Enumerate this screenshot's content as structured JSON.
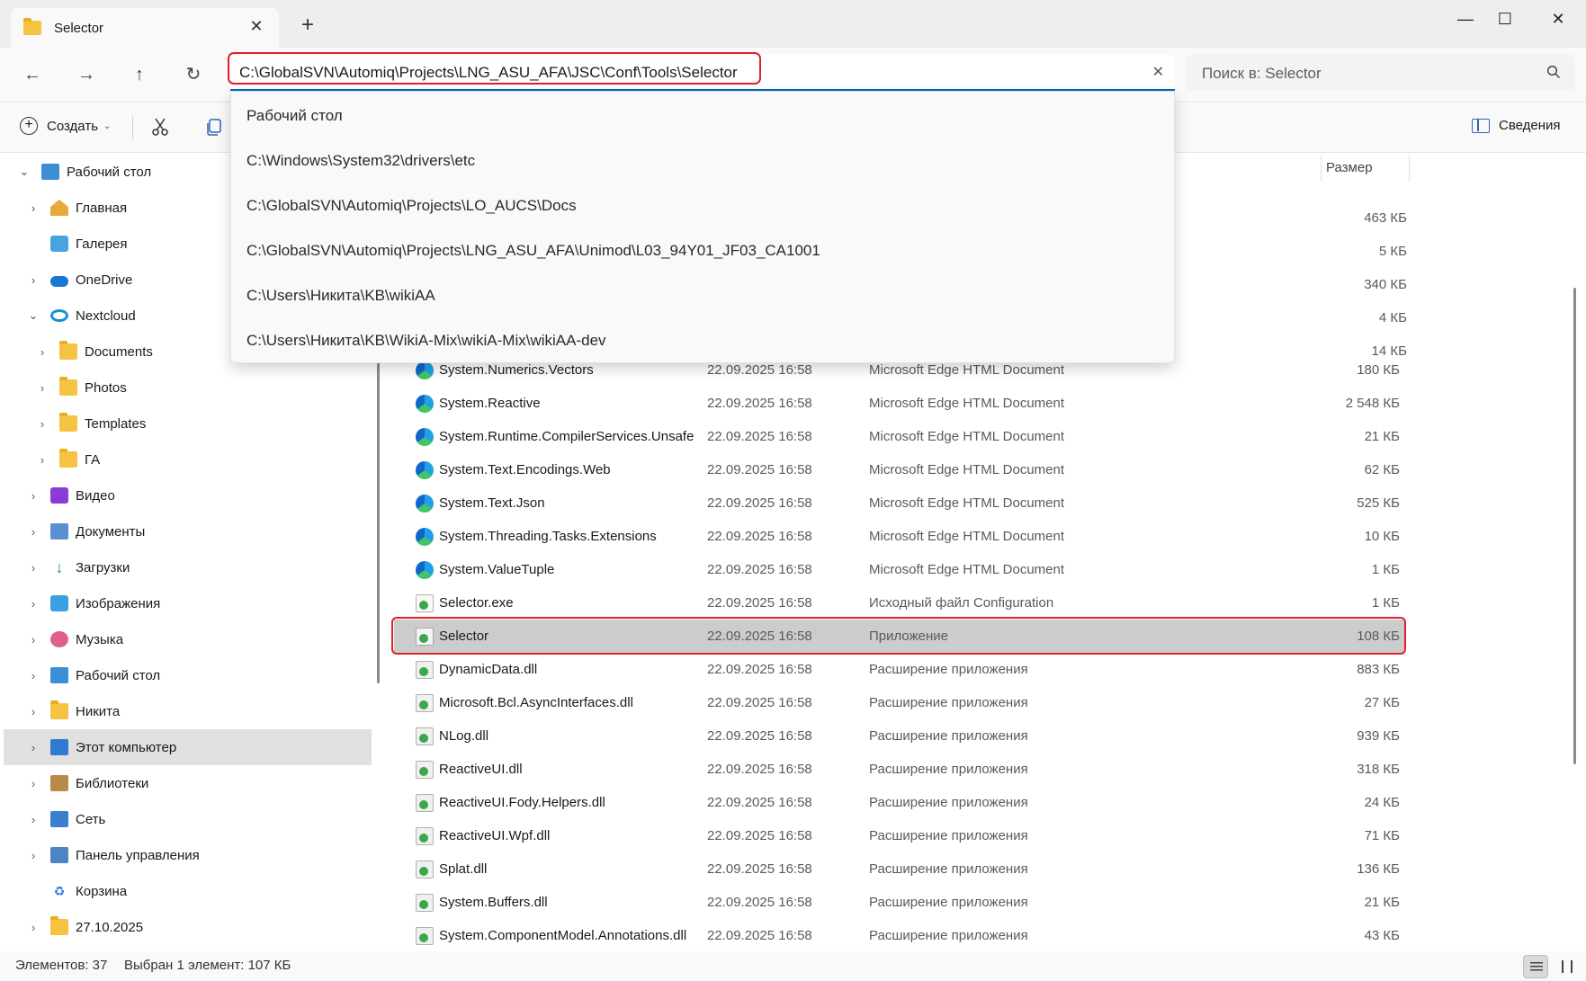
{
  "window": {
    "tab_title": "Selector",
    "tab_close": "✕",
    "new_tab": "+",
    "minimize": "—",
    "maximize": "☐",
    "close": "✕"
  },
  "nav": {
    "back": "←",
    "forward": "→",
    "up": "↑",
    "refresh": "↻",
    "address_value": "C:\\GlobalSVN\\Automiq\\Projects\\LNG_ASU_AFA\\JSC\\Conf\\Tools\\Selector",
    "address_clear": "✕",
    "search_placeholder": "Поиск в: Selector"
  },
  "address_suggestions": [
    "Рабочий стол",
    "C:\\Windows\\System32\\drivers\\etc",
    "C:\\GlobalSVN\\Automiq\\Projects\\LO_AUCS\\Docs",
    "C:\\GlobalSVN\\Automiq\\Projects\\LNG_ASU_AFA\\Unimod\\L03_94Y01_JF03_CA1001",
    "C:\\Users\\Никита\\KB\\wikiAA",
    "C:\\Users\\Никита\\KB\\WikiA-Mix\\wikiA-Mix\\wikiAA-dev"
  ],
  "toolbar": {
    "create_label": "Создать",
    "create_chevron": "⌄",
    "details_label": "Сведения"
  },
  "sidebar": {
    "items": [
      {
        "label": "Рабочий стол",
        "chevron": "⌄",
        "icon": "desktop-icon"
      },
      {
        "label": "Главная",
        "chevron": "›",
        "icon": "home-icon"
      },
      {
        "label": "Галерея",
        "chevron": "",
        "icon": "gallery-icon"
      },
      {
        "label": "OneDrive",
        "chevron": "›",
        "icon": "onedrive-icon"
      },
      {
        "label": "Nextcloud",
        "chevron": "⌄",
        "icon": "nextcloud-icon"
      },
      {
        "label": "Documents",
        "chevron": "›",
        "icon": "folder-icon"
      },
      {
        "label": "Photos",
        "chevron": "›",
        "icon": "folder-icon"
      },
      {
        "label": "Templates",
        "chevron": "›",
        "icon": "folder-icon"
      },
      {
        "label": "ГА",
        "chevron": "›",
        "icon": "folder-icon"
      },
      {
        "label": "Видео",
        "chevron": "›",
        "icon": "video-icon"
      },
      {
        "label": "Документы",
        "chevron": "›",
        "icon": "documents-icon"
      },
      {
        "label": "Загрузки",
        "chevron": "›",
        "icon": "downloads-icon"
      },
      {
        "label": "Изображения",
        "chevron": "›",
        "icon": "pictures-icon"
      },
      {
        "label": "Музыка",
        "chevron": "›",
        "icon": "music-icon"
      },
      {
        "label": "Рабочий стол",
        "chevron": "›",
        "icon": "desktop-folder-icon"
      },
      {
        "label": "Никита",
        "chevron": "›",
        "icon": "user-folder-icon"
      },
      {
        "label": "Этот компьютер",
        "chevron": "›",
        "icon": "this-pc-icon"
      },
      {
        "label": "Библиотеки",
        "chevron": "›",
        "icon": "libraries-icon"
      },
      {
        "label": "Сеть",
        "chevron": "›",
        "icon": "network-icon"
      },
      {
        "label": "Панель управления",
        "chevron": "›",
        "icon": "control-panel-icon"
      },
      {
        "label": "Корзина",
        "chevron": "",
        "icon": "recycle-bin-icon"
      },
      {
        "label": "27.10.2025",
        "chevron": "›",
        "icon": "folder-icon"
      }
    ]
  },
  "filelist": {
    "size_header": "Размер",
    "hidden_sizes": [
      "463 КБ",
      "5 КБ",
      "340 КБ",
      "4 КБ",
      "14 КБ"
    ],
    "rows": [
      {
        "name": "System.Numerics.Vectors",
        "date": "22.09.2025 16:58",
        "type": "Microsoft Edge HTML Document",
        "size": "180 КБ",
        "icon": "edge"
      },
      {
        "name": "System.Reactive",
        "date": "22.09.2025 16:58",
        "type": "Microsoft Edge HTML Document",
        "size": "2 548 КБ",
        "icon": "edge"
      },
      {
        "name": "System.Runtime.CompilerServices.Unsafe",
        "date": "22.09.2025 16:58",
        "type": "Microsoft Edge HTML Document",
        "size": "21 КБ",
        "icon": "edge"
      },
      {
        "name": "System.Text.Encodings.Web",
        "date": "22.09.2025 16:58",
        "type": "Microsoft Edge HTML Document",
        "size": "62 КБ",
        "icon": "edge"
      },
      {
        "name": "System.Text.Json",
        "date": "22.09.2025 16:58",
        "type": "Microsoft Edge HTML Document",
        "size": "525 КБ",
        "icon": "edge"
      },
      {
        "name": "System.Threading.Tasks.Extensions",
        "date": "22.09.2025 16:58",
        "type": "Microsoft Edge HTML Document",
        "size": "10 КБ",
        "icon": "edge"
      },
      {
        "name": "System.ValueTuple",
        "date": "22.09.2025 16:58",
        "type": "Microsoft Edge HTML Document",
        "size": "1 КБ",
        "icon": "edge"
      },
      {
        "name": "Selector.exe",
        "date": "22.09.2025 16:58",
        "type": "Исходный файл Configuration",
        "size": "1 КБ",
        "icon": "cfg"
      },
      {
        "name": "Selector",
        "date": "22.09.2025 16:58",
        "type": "Приложение",
        "size": "108 КБ",
        "icon": "app"
      },
      {
        "name": "DynamicData.dll",
        "date": "22.09.2025 16:58",
        "type": "Расширение приложения",
        "size": "883 КБ",
        "icon": "dll"
      },
      {
        "name": "Microsoft.Bcl.AsyncInterfaces.dll",
        "date": "22.09.2025 16:58",
        "type": "Расширение приложения",
        "size": "27 КБ",
        "icon": "dll"
      },
      {
        "name": "NLog.dll",
        "date": "22.09.2025 16:58",
        "type": "Расширение приложения",
        "size": "939 КБ",
        "icon": "dll"
      },
      {
        "name": "ReactiveUI.dll",
        "date": "22.09.2025 16:58",
        "type": "Расширение приложения",
        "size": "318 КБ",
        "icon": "dll"
      },
      {
        "name": "ReactiveUI.Fody.Helpers.dll",
        "date": "22.09.2025 16:58",
        "type": "Расширение приложения",
        "size": "24 КБ",
        "icon": "dll"
      },
      {
        "name": "ReactiveUI.Wpf.dll",
        "date": "22.09.2025 16:58",
        "type": "Расширение приложения",
        "size": "71 КБ",
        "icon": "dll"
      },
      {
        "name": "Splat.dll",
        "date": "22.09.2025 16:58",
        "type": "Расширение приложения",
        "size": "136 КБ",
        "icon": "dll"
      },
      {
        "name": "System.Buffers.dll",
        "date": "22.09.2025 16:58",
        "type": "Расширение приложения",
        "size": "21 КБ",
        "icon": "dll"
      },
      {
        "name": "System.ComponentModel.Annotations.dll",
        "date": "22.09.2025 16:58",
        "type": "Расширение приложения",
        "size": "43 КБ",
        "icon": "dll"
      }
    ]
  },
  "status": {
    "count": "Элементов: 37",
    "selection": "Выбран 1 элемент: 107 КБ"
  },
  "colors": {
    "accent": "#0067c0",
    "highlight_border": "#e0202a",
    "selected_row": "#cccccc"
  }
}
